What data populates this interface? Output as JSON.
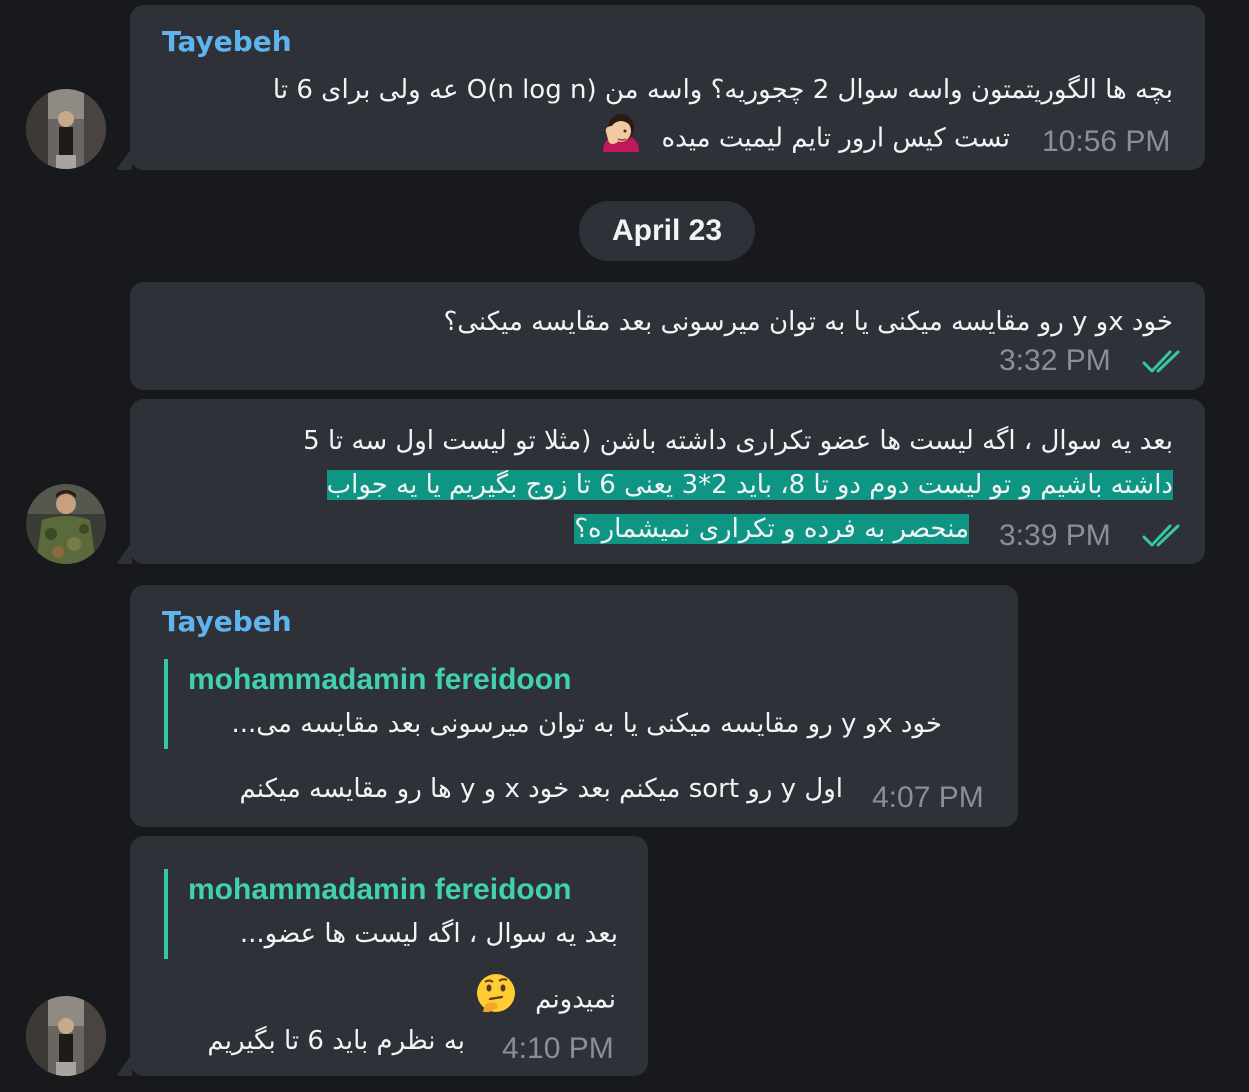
{
  "messages": [
    {
      "sender": "Tayebeh",
      "line1": "بچه ها الگوریتمتون واسه سوال 2 چجوریه؟ واسه من O(n log n) عه ولی برای 6 تا",
      "line2": "تست کیس ارور تایم لیمیت میده",
      "emoji": "face-palm-emoji",
      "time": "10:56 PM"
    },
    {
      "line1": "خود xو y رو مقایسه میکنی یا به توان میرسونی بعد مقایسه میکنی؟",
      "time": "3:32 PM",
      "status": "read"
    },
    {
      "line1": "بعد یه سوال ، اگه لیست ها عضو تکراری داشته باشن (مثلا تو لیست اول سه تا 5",
      "line2": "داشته باشیم و تو لیست دوم دو تا 8، باید 2*3 یعنی 6 تا زوج بگیریم یا یه جواب",
      "line3": "منحصر به فرده و تکراری نمیشماره؟",
      "time": "3:39 PM",
      "status": "read",
      "highlight_color": "#0f9583"
    },
    {
      "sender": "Tayebeh",
      "reply_name": "mohammadamin fereidoon",
      "reply_text": "خود xو y رو مقایسه میکنی یا به توان میرسونی بعد مقایسه می...",
      "line1": "اول y رو sort میکنم بعد خود x و y ها رو مقایسه میکنم",
      "time": "4:07 PM"
    },
    {
      "reply_name": "mohammadamin fereidoon",
      "reply_text": "بعد یه سوال ، اگه لیست ها عضو...",
      "line1": "نمیدونم",
      "emoji": "thinking-face-emoji",
      "line2": "به نظرم باید 6 تا بگیریم",
      "time": "4:10 PM"
    }
  ],
  "date_separator": "April 23",
  "colors": {
    "background": "#17191d",
    "bubble": "#2e3138",
    "sender_name": "#5fb4ee",
    "reply_accent": "#41d1b0",
    "read_ticks": "#35c7a5",
    "highlight": "#0f9583"
  }
}
